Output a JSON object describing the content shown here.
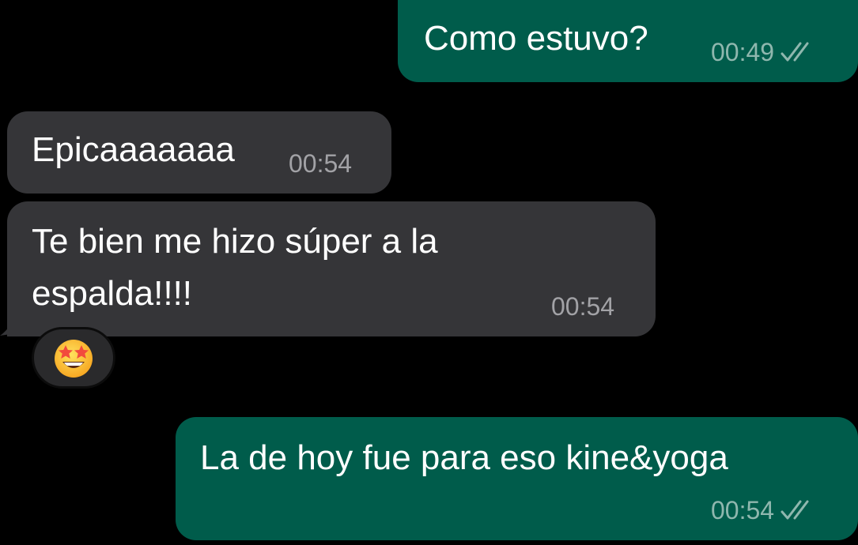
{
  "colors": {
    "background": "#000000",
    "outgoing_bubble": "#005c4b",
    "incoming_bubble": "#353538",
    "outgoing_meta": "#8fb7ae",
    "incoming_meta": "#a2a2a6"
  },
  "messages": [
    {
      "direction": "outgoing",
      "text": "Como estuvo?",
      "time": "00:49",
      "status_icon": "double-check-icon"
    },
    {
      "direction": "incoming",
      "text": "Epicaaaaaaa",
      "time": "00:54"
    },
    {
      "direction": "incoming",
      "lines": [
        "Te bien me hizo súper a la",
        "espalda!!!!"
      ],
      "time": "00:54",
      "reaction": "star-struck-emoji"
    },
    {
      "direction": "outgoing",
      "text": "La de hoy fue para eso kine&yoga",
      "time": "00:54",
      "status_icon": "double-check-icon"
    }
  ]
}
